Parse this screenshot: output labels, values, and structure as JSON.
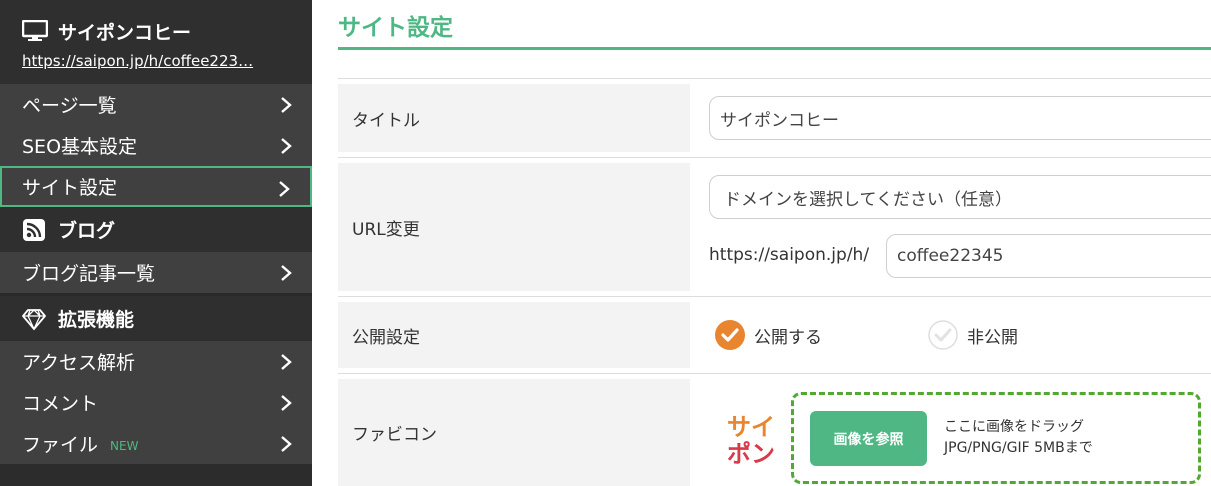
{
  "sidebar": {
    "site_name": "サイポンコヒー",
    "site_url": "https://saipon.jp/h/coffee223…",
    "pages_group": [
      {
        "label": "ページ一覧"
      },
      {
        "label": "SEO基本設定"
      },
      {
        "label": "サイト設定",
        "active": true
      }
    ],
    "blog_section": {
      "title": "ブログ",
      "items": [
        {
          "label": "ブログ記事一覧"
        }
      ]
    },
    "ext_section": {
      "title": "拡張機能",
      "items": [
        {
          "label": "アクセス解析"
        },
        {
          "label": "コメント"
        },
        {
          "label": "ファイル",
          "badge": "NEW"
        }
      ]
    }
  },
  "main": {
    "page_title": "サイト設定",
    "title_row": {
      "label": "タイトル",
      "value": "サイポンコヒー"
    },
    "url_row": {
      "label": "URL変更",
      "domain_select": "ドメインを選択してください（任意）",
      "prefix": "https://saipon.jp/h/",
      "path_value": "coffee22345"
    },
    "publish_row": {
      "label": "公開設定",
      "options": [
        {
          "label": "公開する",
          "selected": true
        },
        {
          "label": "非公開",
          "selected": false
        }
      ]
    },
    "favicon_row": {
      "label": "ファビコン",
      "logo_text_top": "サイ",
      "logo_text_bottom": "ポン",
      "browse_label": "画像を参照",
      "drop_hint_line1": "ここに画像をドラッグ",
      "drop_hint_line2": "JPG/PNG/GIF 5MBまで"
    }
  },
  "colors": {
    "accent": "#4fb784",
    "sidebar_bg": "#404040",
    "sidebar_head_bg": "#2f2f2f",
    "radio_checked": "#e8852e",
    "dropzone_border": "#52a832"
  },
  "icons": {
    "site": "monitor-icon",
    "blog": "rss-icon",
    "ext": "diamond-icon",
    "nav": "chevron-right-icon"
  }
}
